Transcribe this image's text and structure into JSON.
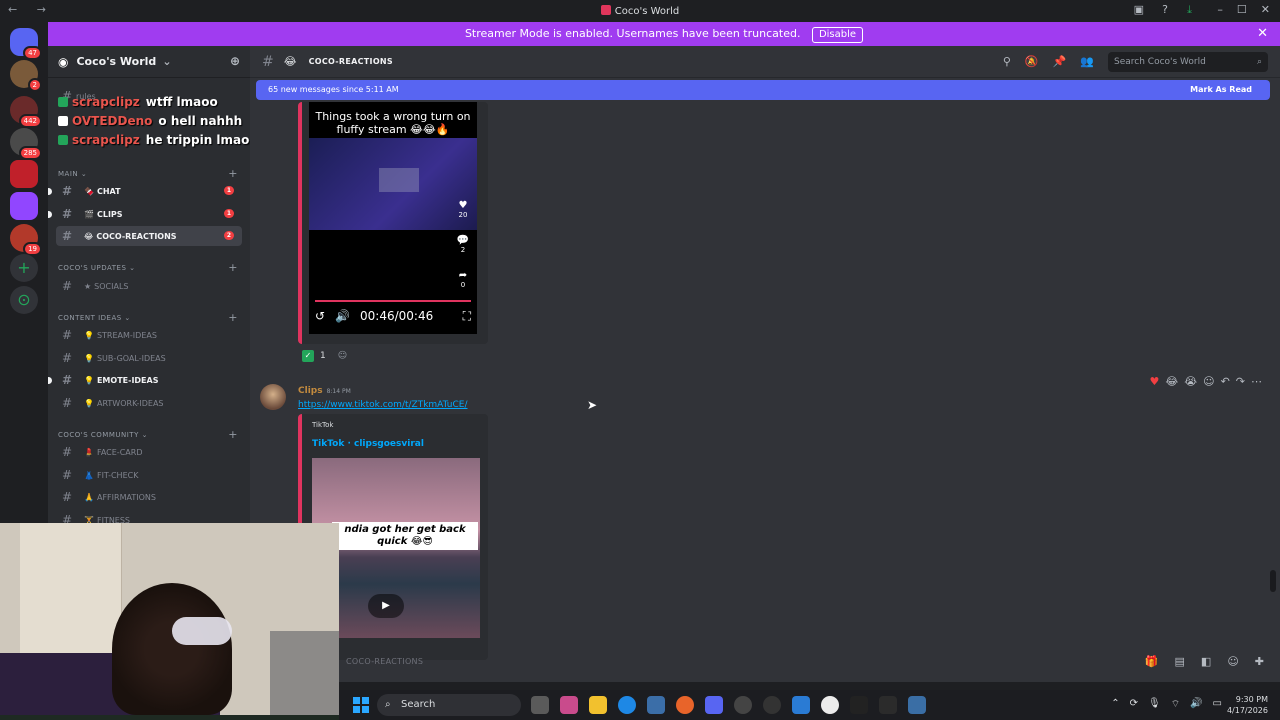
{
  "window": {
    "title": "Coco's World",
    "nav_glyphs": "← →",
    "controls": [
      "–",
      "☐",
      "✕"
    ]
  },
  "servers": [
    {
      "name": "direct-messages",
      "badge": "47"
    },
    {
      "name": "server-1",
      "badge": "2"
    },
    {
      "name": "server-2",
      "badge": "442"
    },
    {
      "name": "server-3",
      "badge": "285"
    },
    {
      "name": "server-4",
      "badge": ""
    },
    {
      "name": "server-5",
      "badge": ""
    },
    {
      "name": "server-6",
      "badge": "19"
    }
  ],
  "banner": {
    "text": "Streamer Mode is enabled. Usernames have been truncated.",
    "disable_label": "Disable"
  },
  "sidebar": {
    "server_name": "Coco's World",
    "rules_label": "rules",
    "rules2_label": "roles",
    "categories": {
      "main": "MAIN",
      "updates": "COCO'S UPDATES",
      "content": "CONTENT IDEAS",
      "community": "COCO'S COMMUNITY"
    },
    "channels": {
      "chat": {
        "label": "CHAT",
        "count": "1"
      },
      "clips": {
        "label": "CLIPS",
        "count": "1"
      },
      "coco_reactions": {
        "label": "COCO-REACTIONS",
        "count": "2"
      },
      "socials": {
        "label": "SOCIALS"
      },
      "stream_ideas": {
        "label": "STREAM-IDEAS"
      },
      "sub_goal_ideas": {
        "label": "SUB-GOAL-IDEAS"
      },
      "emote_ideas": {
        "label": "EMOTE-IDEAS"
      },
      "artwork_ideas": {
        "label": "ARTWORK-IDEAS"
      },
      "face_card": {
        "label": "FACE-CARD"
      },
      "fit_check": {
        "label": "FIT-CHECK"
      },
      "affirmations": {
        "label": "AFFIRMATIONS"
      },
      "fitness": {
        "label": "FITNESS"
      }
    }
  },
  "overlay_chat": [
    {
      "user": "scrapclipz",
      "text": "wtff lmaoo"
    },
    {
      "user": "OVTEDDeno",
      "text": "o hell nahhh"
    },
    {
      "user": "scrapclipz",
      "text": "he trippin lmaoo"
    }
  ],
  "channel_header": {
    "name": "COCO-REACTIONS",
    "search_placeholder": "Search Coco's World"
  },
  "new_messages": {
    "text": "65 new messages since 5:11 AM",
    "mark_read": "Mark As Read"
  },
  "message1": {
    "video_caption": "Things took a wrong turn on fluffy stream 😂😂🔥",
    "likes": "20",
    "comments": "2",
    "shares": "0",
    "time": "00:46/00:46",
    "reaction_count": "1"
  },
  "message2": {
    "author": "Clips",
    "timestamp": "8:14 PM",
    "link": "https://www.tiktok.com/t/ZTkmATuCE/",
    "provider": "TikTok",
    "embed_title": "TikTok · clipsgoesviral",
    "thumb_caption": "ndia got her get back quick 😂😎"
  },
  "composer": {
    "placeholder": "COCO-REACTIONS"
  },
  "taskbar": {
    "search_label": "Search",
    "time": "9:30 PM",
    "date": "4/17/2026"
  }
}
